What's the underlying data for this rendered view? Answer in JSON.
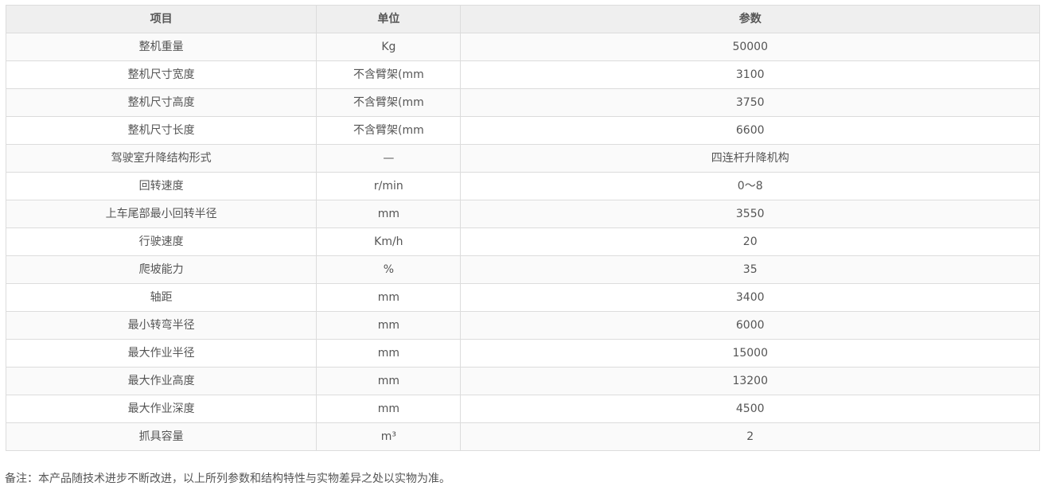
{
  "table": {
    "headers": [
      "项目",
      "单位",
      "参数"
    ],
    "rows": [
      [
        "整机重量",
        "Kg",
        "50000"
      ],
      [
        "整机尺寸宽度",
        "不含臂架(mm",
        "3100"
      ],
      [
        "整机尺寸高度",
        "不含臂架(mm",
        "3750"
      ],
      [
        "整机尺寸长度",
        "不含臂架(mm",
        "6600"
      ],
      [
        "驾驶室升降结构形式",
        "—",
        "四连杆升降机构"
      ],
      [
        "回转速度",
        "r/min",
        "0～8"
      ],
      [
        "上车尾部最小回转半径",
        "mm",
        "3550"
      ],
      [
        "行驶速度",
        "Km/h",
        "20"
      ],
      [
        "爬坡能力",
        "%",
        "35"
      ],
      [
        "轴距",
        "mm",
        "3400"
      ],
      [
        "最小转弯半径",
        "mm",
        "6000"
      ],
      [
        "最大作业半径",
        "mm",
        "15000"
      ],
      [
        "最大作业高度",
        "mm",
        "13200"
      ],
      [
        "最大作业深度",
        "mm",
        "4500"
      ],
      [
        "抓具容量",
        "m³",
        "2"
      ]
    ]
  },
  "note": "备注：本产品随技术进步不断改进，以上所列参数和结构特性与实物差异之处以实物为准。"
}
